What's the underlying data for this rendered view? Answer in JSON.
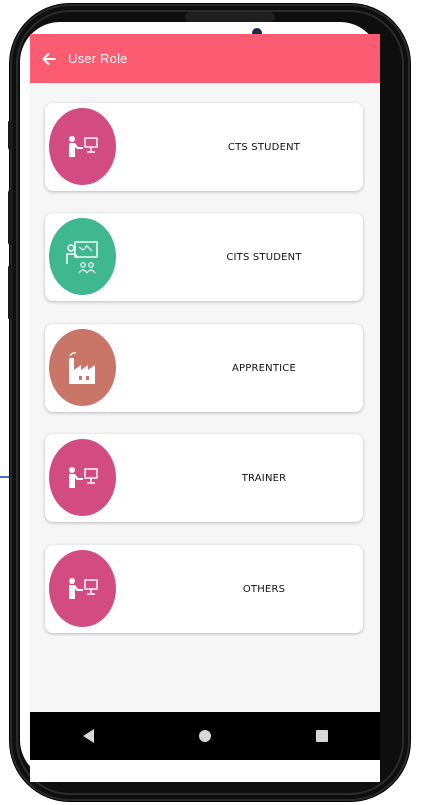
{
  "appbar": {
    "title": "User Role",
    "color": "#fb5c72"
  },
  "roles": [
    {
      "label": "CTS STUDENT",
      "icon": "presenter-computer-icon",
      "color": "#d24c82"
    },
    {
      "label": "CITS STUDENT",
      "icon": "classroom-teacher-icon",
      "color": "#3fb88f"
    },
    {
      "label": "APPRENTICE",
      "icon": "factory-icon",
      "color": "#c97568"
    },
    {
      "label": "TRAINER",
      "icon": "presenter-computer-icon",
      "color": "#d24c82"
    },
    {
      "label": "OTHERS",
      "icon": "presenter-computer-icon",
      "color": "#d24c82"
    }
  ],
  "navbar": {
    "icons": [
      "back-triangle-icon",
      "home-circle-icon",
      "recent-square-icon"
    ]
  },
  "colors": {
    "background": "#f6f6f6",
    "card": "#ffffff",
    "pointer_arrow": "#4a6cc4"
  }
}
